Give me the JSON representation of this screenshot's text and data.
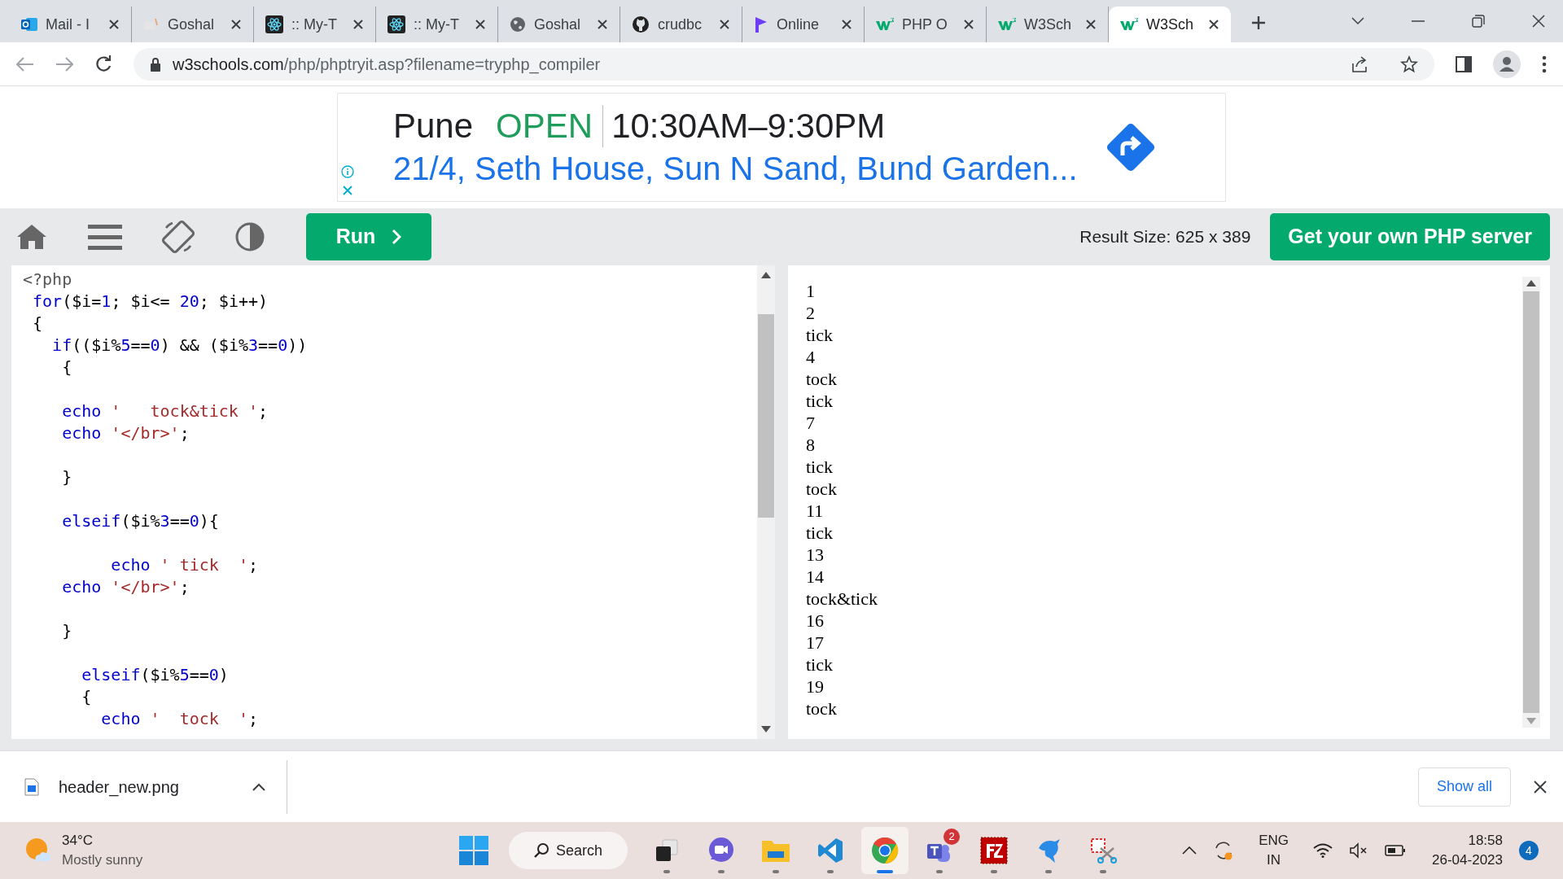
{
  "tabs": [
    {
      "title": "Mail - I",
      "kind": "mail",
      "selected": false
    },
    {
      "title": "Goshal",
      "kind": "faded",
      "selected": false
    },
    {
      "title": ":: My-T",
      "kind": "atom",
      "selected": false
    },
    {
      "title": ":: My-T",
      "kind": "atom",
      "selected": false
    },
    {
      "title": "Goshal",
      "kind": "globe",
      "selected": false
    },
    {
      "title": "crudbc",
      "kind": "cat",
      "selected": false
    },
    {
      "title": "Online",
      "kind": "p",
      "selected": false
    },
    {
      "title": "PHP O",
      "kind": "w3",
      "selected": false
    },
    {
      "title": "W3Sch",
      "kind": "w3",
      "selected": false
    },
    {
      "title": "W3Sch",
      "kind": "w3",
      "selected": true
    }
  ],
  "address": {
    "host": "w3schools.com",
    "path": "/php/phptryit.asp?filename=tryphp_compiler"
  },
  "ad": {
    "city": "Pune",
    "status": "OPEN",
    "hours": "10:30AM–9:30PM",
    "address": "21/4, Seth House, Sun N Sand, Bund Garden..."
  },
  "toolbar": {
    "run": "Run",
    "result_size": "Result Size: 625 x 389",
    "server_button": "Get your own PHP server"
  },
  "code": [
    {
      "kind": "code",
      "tokens": [
        {
          "t": "<?php",
          "kind": "meta"
        }
      ]
    },
    {
      "kind": "code",
      "tokens": [
        {
          "t": " for",
          "kind": "kw"
        },
        {
          "t": "($i=",
          "kind": "plain"
        },
        {
          "t": "1",
          "kind": "num"
        },
        {
          "t": "; $i<= ",
          "kind": "plain"
        },
        {
          "t": "20",
          "kind": "num"
        },
        {
          "t": "; $i++)",
          "kind": "plain"
        }
      ]
    },
    {
      "kind": "code",
      "tokens": [
        {
          "t": " {",
          "kind": "plain"
        }
      ]
    },
    {
      "kind": "code",
      "tokens": [
        {
          "t": "   if",
          "kind": "kw"
        },
        {
          "t": "(($i%",
          "kind": "plain"
        },
        {
          "t": "5",
          "kind": "num"
        },
        {
          "t": "==",
          "kind": "plain"
        },
        {
          "t": "0",
          "kind": "num"
        },
        {
          "t": ") && ($i%",
          "kind": "plain"
        },
        {
          "t": "3",
          "kind": "num"
        },
        {
          "t": "==",
          "kind": "plain"
        },
        {
          "t": "0",
          "kind": "num"
        },
        {
          "t": "))",
          "kind": "plain"
        }
      ]
    },
    {
      "kind": "code",
      "tokens": [
        {
          "t": "    {",
          "kind": "plain"
        }
      ]
    },
    {
      "kind": "blank"
    },
    {
      "kind": "code",
      "tokens": [
        {
          "t": "    echo",
          "kind": "kw"
        },
        {
          "t": " '   tock&tick '",
          "kind": "str"
        },
        {
          "t": ";",
          "kind": "plain"
        }
      ]
    },
    {
      "kind": "code",
      "tokens": [
        {
          "t": "    echo",
          "kind": "kw"
        },
        {
          "t": " '</br>'",
          "kind": "str"
        },
        {
          "t": ";",
          "kind": "plain"
        }
      ]
    },
    {
      "kind": "blank"
    },
    {
      "kind": "code",
      "tokens": [
        {
          "t": "    }",
          "kind": "plain"
        }
      ]
    },
    {
      "kind": "blank"
    },
    {
      "kind": "code",
      "tokens": [
        {
          "t": "    elseif",
          "kind": "kw"
        },
        {
          "t": "($i%",
          "kind": "plain"
        },
        {
          "t": "3",
          "kind": "num"
        },
        {
          "t": "==",
          "kind": "plain"
        },
        {
          "t": "0",
          "kind": "num"
        },
        {
          "t": "){",
          "kind": "plain"
        }
      ]
    },
    {
      "kind": "blank"
    },
    {
      "kind": "code",
      "tokens": [
        {
          "t": "         echo",
          "kind": "kw"
        },
        {
          "t": " ' tick  '",
          "kind": "str"
        },
        {
          "t": ";",
          "kind": "plain"
        }
      ]
    },
    {
      "kind": "code",
      "tokens": [
        {
          "t": "    echo",
          "kind": "kw"
        },
        {
          "t": " '</br>'",
          "kind": "str"
        },
        {
          "t": ";",
          "kind": "plain"
        }
      ]
    },
    {
      "kind": "blank"
    },
    {
      "kind": "code",
      "tokens": [
        {
          "t": "    }",
          "kind": "plain"
        }
      ]
    },
    {
      "kind": "blank"
    },
    {
      "kind": "code",
      "tokens": [
        {
          "t": "      elseif",
          "kind": "kw"
        },
        {
          "t": "($i%",
          "kind": "plain"
        },
        {
          "t": "5",
          "kind": "num"
        },
        {
          "t": "==",
          "kind": "plain"
        },
        {
          "t": "0",
          "kind": "num"
        },
        {
          "t": ")",
          "kind": "plain"
        }
      ]
    },
    {
      "kind": "code",
      "tokens": [
        {
          "t": "      {",
          "kind": "plain"
        }
      ]
    },
    {
      "kind": "code",
      "tokens": [
        {
          "t": "        echo",
          "kind": "kw"
        },
        {
          "t": " '  tock  '",
          "kind": "str"
        },
        {
          "t": ";",
          "kind": "plain"
        }
      ]
    }
  ],
  "result": [
    "1",
    "2",
    "tick",
    "4",
    "tock",
    "tick",
    "7",
    "8",
    "tick",
    "tock",
    "11",
    "tick",
    "13",
    "14",
    "tock&tick",
    "16",
    "17",
    "tick",
    "19",
    "tock"
  ],
  "download": {
    "file": "header_new.png",
    "show_all": "Show all"
  },
  "taskbar": {
    "temp": "34°C",
    "weather": "Mostly sunny",
    "search": "Search",
    "apps": [
      {
        "kind": "taskview",
        "selected": false
      },
      {
        "kind": "meet",
        "selected": false
      },
      {
        "kind": "folder",
        "selected": false
      },
      {
        "kind": "vscode",
        "selected": false
      },
      {
        "kind": "chrome",
        "selected": true
      },
      {
        "kind": "teams",
        "selected": false,
        "badge": "2"
      },
      {
        "kind": "filezilla",
        "selected": false
      },
      {
        "kind": "dolphin",
        "selected": false
      },
      {
        "kind": "snip",
        "selected": false
      }
    ],
    "lang": "ENG",
    "region": "IN",
    "time": "18:58",
    "date": "26-04-2023",
    "notifications": "4"
  }
}
